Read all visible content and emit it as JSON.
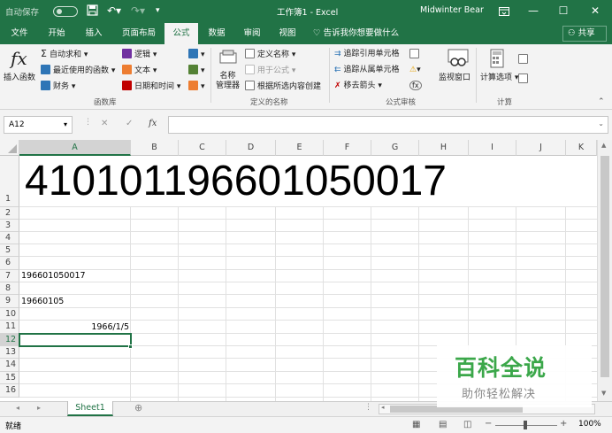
{
  "titlebar": {
    "autosave_label": "自动保存",
    "autosave_state": "关",
    "filename": "工作簿1",
    "separator": "-",
    "app_name": "Excel",
    "user_name": "Midwinter Bear"
  },
  "tabs": [
    "文件",
    "开始",
    "插入",
    "页面布局",
    "公式",
    "数据",
    "审阅",
    "视图"
  ],
  "active_tab": "公式",
  "tell_me": "告诉我你想要做什么",
  "share_label": "共享",
  "ribbon": {
    "insert_function": "插入函数",
    "autosum": "自动求和",
    "recent": "最近使用的函数",
    "financial": "财务",
    "logical": "逻辑",
    "text": "文本",
    "datetime": "日期和时间",
    "group_library": "函数库",
    "name_manager_1": "名称",
    "name_manager_2": "管理器",
    "define_name": "定义名称",
    "use_in_formula": "用于公式",
    "create_from_selection": "根据所选内容创建",
    "group_names": "定义的名称",
    "trace_precedents": "追踪引用单元格",
    "trace_dependents": "追踪从属单元格",
    "remove_arrows": "移去箭头",
    "watch_window": "监视窗口",
    "group_auditing": "公式审核",
    "calc_options": "计算选项",
    "group_calc": "计算"
  },
  "formula_bar": {
    "name_box": "A12",
    "fx": "fx",
    "cancel": "✕",
    "enter": "✓",
    "formula": ""
  },
  "columns": [
    "A",
    "B",
    "C",
    "D",
    "E",
    "F",
    "G",
    "H",
    "I",
    "J",
    "K"
  ],
  "rows": [
    "1",
    "2",
    "3",
    "4",
    "5",
    "6",
    "7",
    "8",
    "9",
    "10",
    "11",
    "12",
    "13",
    "14",
    "15",
    "16"
  ],
  "cells": {
    "A1": "410101196601050017",
    "A7": "196601050017",
    "A9": "19660105",
    "A11": "1966/1/5"
  },
  "sheet_tabs": [
    "Sheet1"
  ],
  "status": {
    "ready": "就绪",
    "zoom": "100%"
  },
  "watermark": {
    "title": "百科全说",
    "subtitle": "助你轻松解决"
  },
  "colors": {
    "excel_green": "#217346",
    "watermark_green": "#3ba74a"
  }
}
